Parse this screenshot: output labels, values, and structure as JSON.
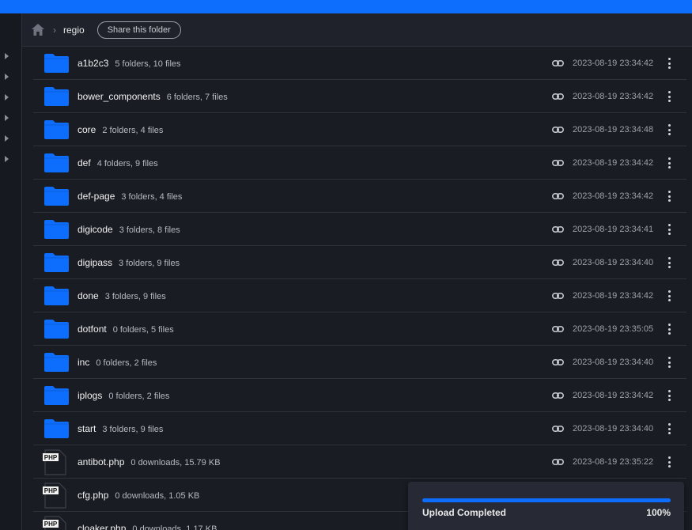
{
  "breadcrumb": {
    "current": "regio",
    "share_label": "Share this folder"
  },
  "accent_color": "#0d6efd",
  "rows": [
    {
      "type": "folder",
      "name": "a1b2c3",
      "meta": "5 folders, 10 files",
      "date": "2023-08-19 23:34:42"
    },
    {
      "type": "folder",
      "name": "bower_components",
      "meta": "6 folders, 7 files",
      "date": "2023-08-19 23:34:42"
    },
    {
      "type": "folder",
      "name": "core",
      "meta": "2 folders, 4 files",
      "date": "2023-08-19 23:34:48"
    },
    {
      "type": "folder",
      "name": "def",
      "meta": "4 folders, 9 files",
      "date": "2023-08-19 23:34:42"
    },
    {
      "type": "folder",
      "name": "def-page",
      "meta": "3 folders, 4 files",
      "date": "2023-08-19 23:34:42"
    },
    {
      "type": "folder",
      "name": "digicode",
      "meta": "3 folders, 8 files",
      "date": "2023-08-19 23:34:41"
    },
    {
      "type": "folder",
      "name": "digipass",
      "meta": "3 folders, 9 files",
      "date": "2023-08-19 23:34:40"
    },
    {
      "type": "folder",
      "name": "done",
      "meta": "3 folders, 9 files",
      "date": "2023-08-19 23:34:42"
    },
    {
      "type": "folder",
      "name": "dotfont",
      "meta": "0 folders, 5 files",
      "date": "2023-08-19 23:35:05"
    },
    {
      "type": "folder",
      "name": "inc",
      "meta": "0 folders, 2 files",
      "date": "2023-08-19 23:34:40"
    },
    {
      "type": "folder",
      "name": "iplogs",
      "meta": "0 folders, 2 files",
      "date": "2023-08-19 23:34:42"
    },
    {
      "type": "folder",
      "name": "start",
      "meta": "3 folders, 9 files",
      "date": "2023-08-19 23:34:40"
    },
    {
      "type": "file",
      "badge": "PHP",
      "name": "antibot.php",
      "meta": "0 downloads, 15.79 KB",
      "date": "2023-08-19 23:35:22"
    },
    {
      "type": "file",
      "badge": "PHP",
      "name": "cfg.php",
      "meta": "0 downloads, 1.05 KB",
      "date": ""
    },
    {
      "type": "file",
      "badge": "PHP",
      "name": "cloaker.php",
      "meta": "0 downloads, 1.17 KB",
      "date": ""
    }
  ],
  "upload": {
    "label": "Upload Completed",
    "percent_text": "100%",
    "progress": 1.0
  }
}
